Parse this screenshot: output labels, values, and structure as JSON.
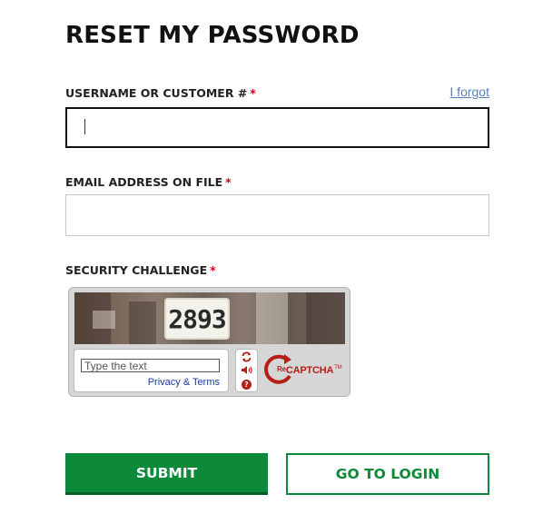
{
  "page": {
    "title": "RESET MY PASSWORD"
  },
  "form": {
    "username": {
      "label": "USERNAME OR CUSTOMER #",
      "required_mark": "*",
      "value": "",
      "forgot_link": "I forgot"
    },
    "email": {
      "label": "EMAIL ADDRESS ON FILE",
      "required_mark": "*",
      "value": ""
    },
    "security": {
      "label": "SECURITY CHALLENGE",
      "required_mark": "*"
    }
  },
  "captcha": {
    "challenge_text": "2893",
    "input_placeholder": "Type the text",
    "privacy_label": "Privacy",
    "amp": "&",
    "terms_label": "Terms",
    "logo_prefix": "Re",
    "logo_text": "CAPTCHA",
    "logo_tm": "TM",
    "icons": [
      "refresh-icon",
      "audio-icon",
      "help-icon"
    ],
    "help_glyph": "?"
  },
  "buttons": {
    "submit": "SUBMIT",
    "go_to_login": "GO TO LOGIN"
  },
  "colors": {
    "brand_green": "#0c8a3a",
    "required_red": "#d0021b",
    "link_blue": "#5a7fb8",
    "recaptcha_red": "#b41e16"
  }
}
